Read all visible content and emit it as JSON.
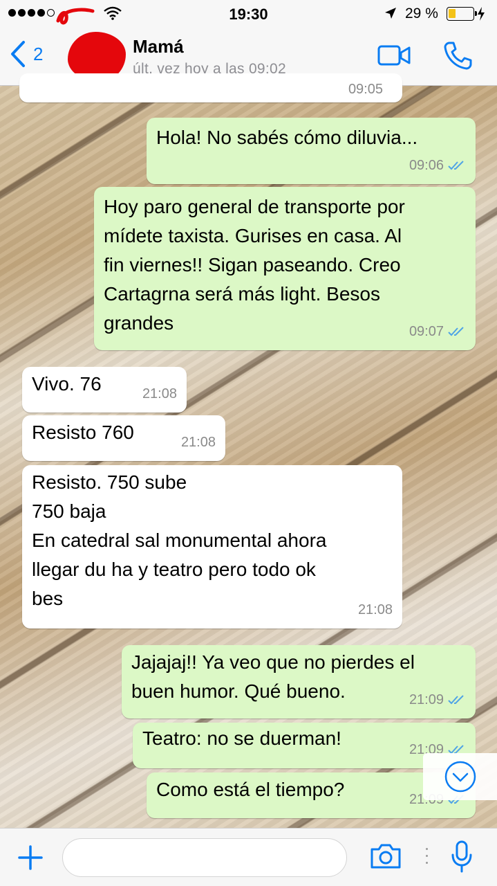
{
  "status_bar": {
    "time": "19:30",
    "battery_percent": "29 %",
    "battery_level": 0.29
  },
  "header": {
    "back_count": "2",
    "contact_name": "Mamá",
    "last_seen": "últ. vez hoy a las 09:02",
    "icons": {
      "back": "chevron-left-icon",
      "video": "video-camera-icon",
      "call": "phone-icon"
    }
  },
  "messages": [
    {
      "direction": "in",
      "text": "",
      "time": "09:05",
      "status": ""
    },
    {
      "direction": "out",
      "text": "Hola! No sabés cómo diluvia...",
      "time": "09:06",
      "status": "read"
    },
    {
      "direction": "out",
      "text": "Hoy paro general de transporte por\nmídete taxista. Gurises en casa. Al\nfin viernes!!  Sigan paseando. Creo\nCartagrna será más light. Besos\ngrandes",
      "time": "09:07",
      "status": "read"
    },
    {
      "direction": "in",
      "text": "Vivo. 76",
      "time": "21:08",
      "status": ""
    },
    {
      "direction": "in",
      "text": "Resisto 760",
      "time": "21:08",
      "status": ""
    },
    {
      "direction": "in",
      "text": "Resisto. 750 sube\n750 baja\n En catedral sal monumental ahora\nllegar du ha y teatro pero todo ok\nbes",
      "time": "21:08",
      "status": ""
    },
    {
      "direction": "out",
      "text": "Jajajaj!! Ya veo que no pierdes el\nbuen humor. Qué bueno.",
      "time": "21:09",
      "status": "read"
    },
    {
      "direction": "out",
      "text": "Teatro: no se duerman!",
      "time": "21:09",
      "status": "read"
    },
    {
      "direction": "out",
      "text": "Como está el tiempo?",
      "time": "21:09",
      "status": "read"
    }
  ],
  "colors": {
    "accent": "#0a7cf2",
    "outgoing_bubble": "#dcf8c6",
    "incoming_bubble": "#ffffff",
    "read_check": "#4fa3e6",
    "avatar_scribble": "#e4070c"
  },
  "input_bar": {
    "placeholder": "",
    "icons": [
      "plus-icon",
      "camera-icon",
      "more-dots-icon",
      "microphone-icon"
    ]
  }
}
